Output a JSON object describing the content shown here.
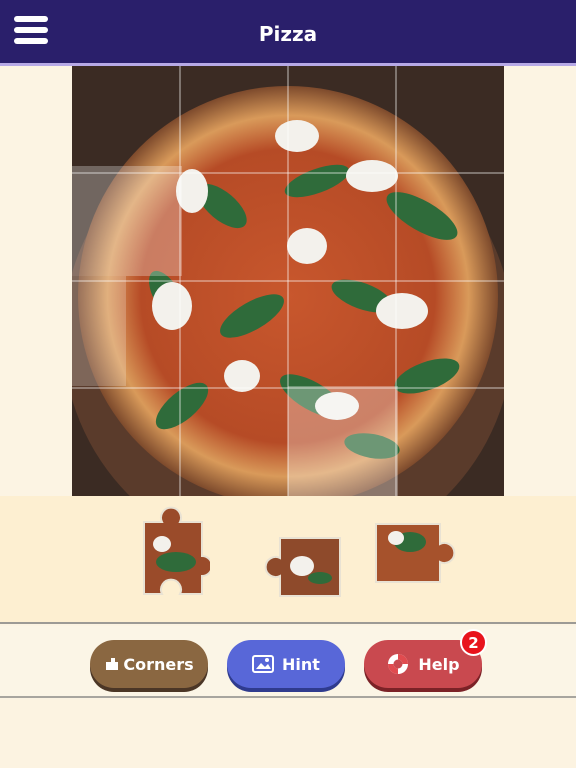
{
  "header": {
    "title": "Pizza"
  },
  "buttons": {
    "corners_label": "Corners",
    "hint_label": "Hint",
    "help_label": "Help",
    "help_badge": "2"
  },
  "puzzle": {
    "grid_rows": 4,
    "grid_cols": 4,
    "pieces_in_tray": 3
  },
  "colors": {
    "header": "#2a1f6b",
    "corners": "#8a6741",
    "hint": "#5867d8",
    "help": "#c9494f",
    "badge": "#e8141d"
  }
}
